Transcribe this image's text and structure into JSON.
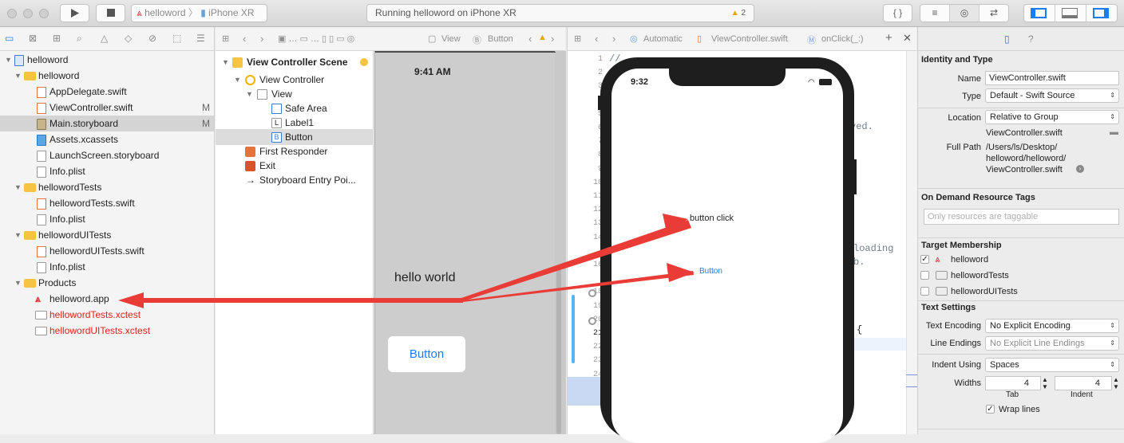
{
  "toolbar": {
    "scheme_target": "helloword",
    "scheme_device": "iPhone XR",
    "activity": "Running helloword on iPhone XR",
    "warnings": "2",
    "braces": "{ }"
  },
  "navigator": {
    "items": [
      {
        "label": "helloword",
        "kind": "project"
      },
      {
        "label": "helloword",
        "kind": "folder"
      },
      {
        "label": "AppDelegate.swift",
        "kind": "swift"
      },
      {
        "label": "ViewController.swift",
        "kind": "swift",
        "badge": "M"
      },
      {
        "label": "Main.storyboard",
        "kind": "storyboard",
        "badge": "M"
      },
      {
        "label": "Assets.xcassets",
        "kind": "assets"
      },
      {
        "label": "LaunchScreen.storyboard",
        "kind": "storyboard"
      },
      {
        "label": "Info.plist",
        "kind": "plist"
      },
      {
        "label": "hellowordTests",
        "kind": "folder"
      },
      {
        "label": "hellowordTests.swift",
        "kind": "swift"
      },
      {
        "label": "Info.plist",
        "kind": "plist"
      },
      {
        "label": "hellowordUITests",
        "kind": "folder"
      },
      {
        "label": "hellowordUITests.swift",
        "kind": "swift"
      },
      {
        "label": "Info.plist",
        "kind": "plist"
      },
      {
        "label": "Products",
        "kind": "folder"
      },
      {
        "label": "helloword.app",
        "kind": "app"
      },
      {
        "label": "hellowordTests.xctest",
        "kind": "xctest"
      },
      {
        "label": "hellowordUITests.xctest",
        "kind": "xctest"
      }
    ]
  },
  "jumpbar1": {
    "crumb1": "View",
    "crumb2": "Button"
  },
  "outline": {
    "scene": "View Controller Scene",
    "vc": "View Controller",
    "view": "View",
    "safe_area": "Safe Area",
    "label1": "Label1",
    "button": "Button",
    "first_responder": "First Responder",
    "exit": "Exit",
    "entry": "Storyboard Entry Poi..."
  },
  "scene": {
    "time": "9:41 AM",
    "label": "hello world",
    "button": "Button"
  },
  "jumpbar2": {
    "auto": "Automatic",
    "file": "ViewController.swift",
    "func": "onClick(_:)"
  },
  "editor": {
    "line_numbers": [
      "1",
      "2",
      "3",
      "4",
      "5",
      "6",
      "7",
      "8",
      "9",
      "10",
      "11",
      "12",
      "13",
      "14",
      "",
      "16",
      "",
      "18",
      "19",
      "20",
      "21",
      "22",
      "23",
      "24",
      "25"
    ],
    "code_first": "//",
    "code_frag1": "ved.",
    "code_frag2": "loading",
    "code_frag3": "b.",
    "code_frag4": "{"
  },
  "simulator": {
    "time": "9:32",
    "label": "button click",
    "button": "Button"
  },
  "inspector": {
    "identity_title": "Identity and Type",
    "name_label": "Name",
    "name_value": "ViewController.swift",
    "type_label": "Type",
    "type_value": "Default - Swift Source",
    "location_label": "Location",
    "location_value": "Relative to Group",
    "location_file": "ViewController.swift",
    "fullpath_label": "Full Path",
    "fullpath_1": "/Users/ls/Desktop/",
    "fullpath_2": "helloword/helloword/",
    "fullpath_3": "ViewController.swift",
    "tags_title": "On Demand Resource Tags",
    "tags_placeholder": "Only resources are taggable",
    "target_title": "Target Membership",
    "targets": [
      "helloword",
      "hellowordTests",
      "hellowordUITests"
    ],
    "text_title": "Text Settings",
    "encoding_label": "Text Encoding",
    "encoding_value": "No Explicit Encoding",
    "endings_label": "Line Endings",
    "endings_value": "No Explicit Line Endings",
    "indent_label": "Indent Using",
    "indent_value": "Spaces",
    "widths_label": "Widths",
    "tab_value": "4",
    "indent_width_value": "4",
    "tab_label": "Tab",
    "indent_sub_label": "Indent",
    "wrap_label": "Wrap lines"
  },
  "colors": {
    "accent": "#1a7cf5",
    "arrow": "#ea3c37",
    "red_file": "#e0211b"
  }
}
